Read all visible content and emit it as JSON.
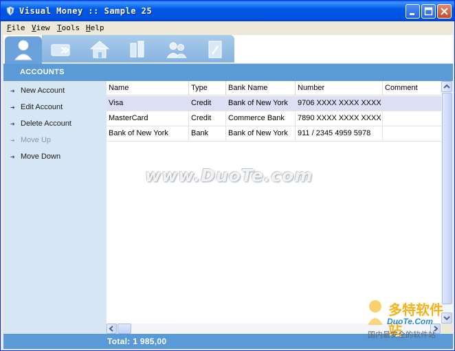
{
  "window": {
    "title": "Visual Money :: Sample 25"
  },
  "menu": [
    "File",
    "View",
    "Tools",
    "Help"
  ],
  "toolbar": {
    "icons": [
      "accounts-icon",
      "transfers-icon",
      "home-icon",
      "reports-icon",
      "payees-icon",
      "notes-icon"
    ],
    "active_index": 0
  },
  "section": {
    "title": "ACCOUNTS"
  },
  "sidebar": {
    "items": [
      {
        "label": "New Account",
        "enabled": true
      },
      {
        "label": "Edit Account",
        "enabled": true
      },
      {
        "label": "Delete Account",
        "enabled": true
      },
      {
        "label": "Move Up",
        "enabled": false
      },
      {
        "label": "Move Down",
        "enabled": true
      }
    ]
  },
  "table": {
    "columns": [
      "Name",
      "Type",
      "Bank Name",
      "Number",
      "Comment"
    ],
    "rows": [
      [
        "Visa",
        "Credit",
        "Bank of New York",
        "9706 XXXX XXXX XXXX",
        ""
      ],
      [
        "MasterCard",
        "Credit",
        "Commerce Bank",
        "7890 XXXX XXXX XXXX",
        ""
      ],
      [
        "Bank of New York",
        "Bank",
        "Bank of New York",
        "911 / 2345 4959 5978",
        ""
      ]
    ],
    "selected_row": 0
  },
  "status": {
    "total": "Total: 1 985,00"
  },
  "watermark": {
    "main": "www.DuoTe.com",
    "cn_title": "多特软件站",
    "cn_site": "DuoTe.Com",
    "cn_slogan": "国内最安全的软件站"
  }
}
